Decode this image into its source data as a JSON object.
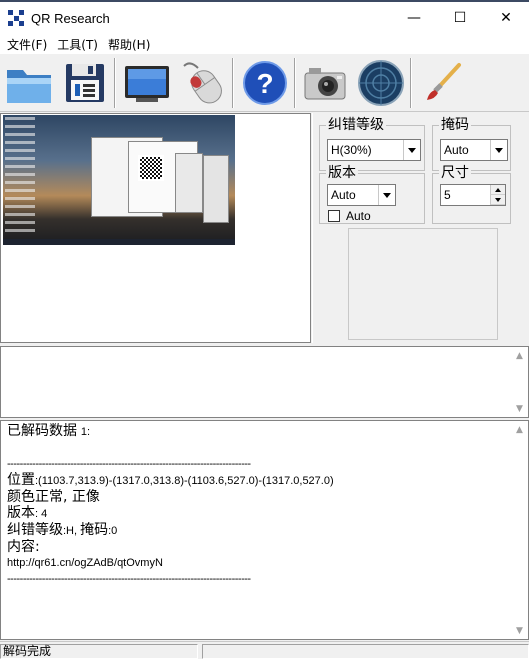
{
  "window": {
    "title": "QR Research",
    "minimize_glyph": "—",
    "maximize_glyph": "☐",
    "close_glyph": "✕"
  },
  "menu": [
    "文件(F)",
    "工具(T)",
    "帮助(H)"
  ],
  "toolbar": {
    "buttons": [
      "open-folder-icon",
      "save-disk-icon",
      "monitor-icon",
      "mouse-icon",
      "help-icon",
      "camera-icon",
      "radar-scan-icon",
      "brush-icon"
    ]
  },
  "settings": {
    "ec_level": {
      "label": "纠错等级",
      "value": "H(30%)"
    },
    "mask": {
      "label": "掩码",
      "value": "Auto"
    },
    "version": {
      "label": "版本",
      "value": "Auto",
      "auto_label": "Auto",
      "auto_checked": false
    },
    "size": {
      "label": "尺寸",
      "value": "5"
    }
  },
  "output": {
    "header": "已解码数据",
    "header_index": "1:",
    "separator": "-----------------------------------------------------------------------------",
    "position_label": "位置",
    "position_value": ":(1103.7,313.9)-(1317.0,313.8)-(1103.6,527.0)-(1317.0,527.0)",
    "color_line": "颜色正常, 正像",
    "version_label": "版本",
    "version_value": ": 4",
    "ec_label": "纠错等级",
    "ec_value": ":H, ",
    "mask_label": "掩码",
    "mask_value": ":0",
    "content_label": "内容:",
    "content_value": "http://qr61.cn/ogZAdB/qtOvmyN",
    "separator2": "-----------------------------------------------------------------------------"
  },
  "status": {
    "text": "解码完成"
  },
  "colors": {
    "accent": "#1b3f8f",
    "window_bg": "#f0f0f0",
    "titlebar_border": "#3c4a63"
  }
}
